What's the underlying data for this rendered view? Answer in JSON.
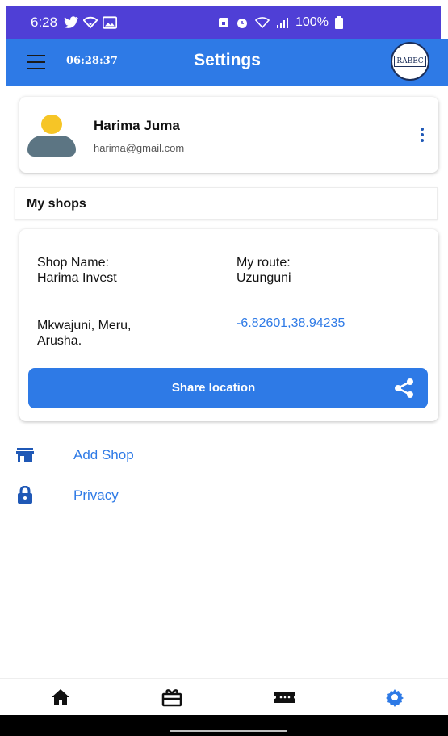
{
  "status_bar": {
    "time": "6:28",
    "battery": "100%"
  },
  "app_bar": {
    "clock": "06:28:37",
    "title": "Settings",
    "logo_text": "RABEC"
  },
  "profile": {
    "name": "Harima Juma",
    "email": "harima@gmail.com"
  },
  "section": {
    "my_shops": "My shops"
  },
  "shop": {
    "name_label": "Shop Name:",
    "name_value": "Harima Invest",
    "route_label": "My route:",
    "route_value": "Uzunguni",
    "address_line1": "Mkwajuni, Meru,",
    "address_line2": "Arusha.",
    "coordinates": "-6.82601,38.94235",
    "share_label": "Share location"
  },
  "menu": {
    "add_shop": "Add Shop",
    "privacy": "Privacy"
  },
  "colors": {
    "primary": "#2e7ae6",
    "status_bar": "#4f3fd6",
    "nav_active": "#2e7ae6"
  },
  "icons": {
    "menu": "hamburger-icon",
    "more": "kebab-icon",
    "share": "share-icon",
    "add_shop": "store-icon",
    "privacy": "lock-icon",
    "nav": [
      "home-icon",
      "gift-icon",
      "ticket-icon",
      "gear-icon"
    ]
  }
}
